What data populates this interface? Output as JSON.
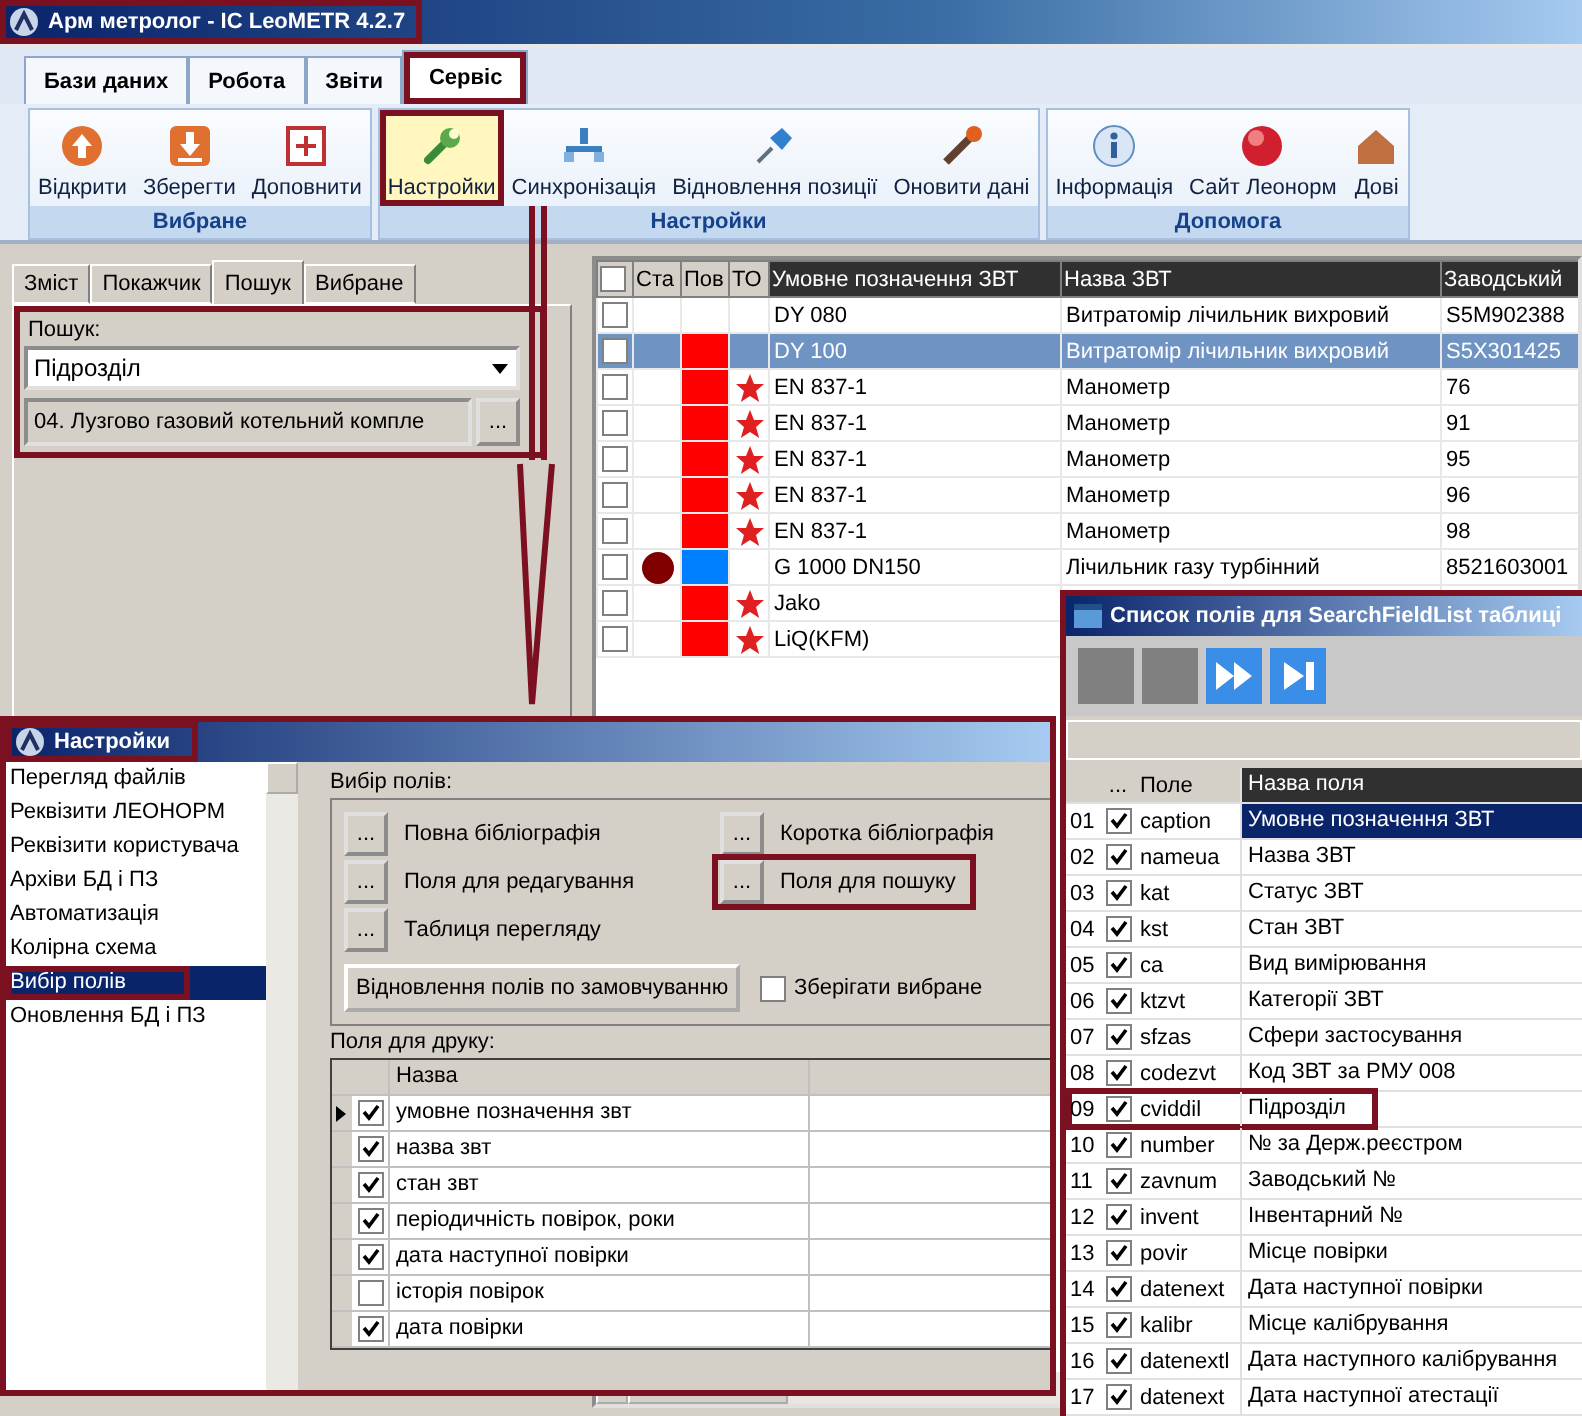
{
  "window": {
    "title": "Арм метролог - IC LeoMETR 4.2.7"
  },
  "ribbon_tabs": [
    {
      "label": "Бази даних",
      "selected": false
    },
    {
      "label": "Робота",
      "selected": false
    },
    {
      "label": "Звіти",
      "selected": false
    },
    {
      "label": "Сервіс",
      "selected": true
    }
  ],
  "ribbon_groups": [
    {
      "title": "Вибране",
      "buttons": [
        {
          "label": "Відкрити",
          "selected": false
        },
        {
          "label": "Зберегти",
          "selected": false
        },
        {
          "label": "Доповнити",
          "selected": false
        }
      ]
    },
    {
      "title": "Настройки",
      "buttons": [
        {
          "label": "Настройки",
          "selected": true
        },
        {
          "label": "Синхронізація",
          "selected": false
        },
        {
          "label": "Відновлення позиції",
          "selected": false
        },
        {
          "label": "Оновити дані",
          "selected": false
        }
      ]
    },
    {
      "title": "Допомога",
      "buttons": [
        {
          "label": "Інформація",
          "selected": false
        },
        {
          "label": "Сайт  Леонорм",
          "selected": false
        },
        {
          "label": "Дові",
          "selected": false
        }
      ]
    }
  ],
  "side_tabs": [
    {
      "label": "Зміст",
      "selected": false
    },
    {
      "label": "Покажчик",
      "selected": false
    },
    {
      "label": "Пошук",
      "selected": true
    },
    {
      "label": "Вибране",
      "selected": false
    }
  ],
  "search": {
    "label": "Пошук:",
    "field": "Підрозділ",
    "value": "04. Лузгово газовий котельний компле",
    "button": "..."
  },
  "table": {
    "all_checked": false,
    "columns": [
      "Ста",
      "Пов",
      "ТО",
      "Умовне позначення ЗВТ",
      "Назва ЗВТ",
      "Заводський"
    ],
    "rows": [
      {
        "checked": false,
        "selected": false,
        "star": false,
        "caption": "DY 080",
        "name": "Витратомір лічильник вихровий",
        "serial": "S5M902388"
      },
      {
        "checked": false,
        "selected": true,
        "star": false,
        "pov_mark": {
          "color": "#ff0000"
        },
        "caption": "DY 100",
        "name": "Витратомір лічильник вихровий",
        "serial": "S5X301425"
      },
      {
        "checked": false,
        "selected": false,
        "star": true,
        "pov_mark": {
          "color": "#ff0000"
        },
        "caption": "EN 837-1",
        "name": "Манометр",
        "serial": "76"
      },
      {
        "checked": false,
        "selected": false,
        "star": true,
        "pov_mark": {
          "color": "#ff0000"
        },
        "caption": "EN 837-1",
        "name": "Манометр",
        "serial": "91"
      },
      {
        "checked": false,
        "selected": false,
        "star": true,
        "pov_mark": {
          "color": "#ff0000"
        },
        "caption": "EN 837-1",
        "name": "Манометр",
        "serial": "95"
      },
      {
        "checked": false,
        "selected": false,
        "star": true,
        "pov_mark": {
          "color": "#ff0000"
        },
        "caption": "EN 837-1",
        "name": "Манометр",
        "serial": "96"
      },
      {
        "checked": false,
        "selected": false,
        "star": true,
        "pov_mark": {
          "color": "#ff0000"
        },
        "caption": "EN 837-1",
        "name": "Манометр",
        "serial": "98"
      },
      {
        "checked": false,
        "selected": false,
        "star": false,
        "status_mark": {
          "color": "#800000"
        },
        "pov_mark": {
          "color": "#0080ff"
        },
        "caption": "G 1000 DN150",
        "name": "Лічильник газу турбінний",
        "serial": "8521603001"
      },
      {
        "checked": false,
        "selected": false,
        "star": true,
        "pov_mark": {
          "color": "#ff0000"
        },
        "caption": "Jako"
      },
      {
        "checked": false,
        "selected": false,
        "star": true,
        "pov_mark": {
          "color": "#ff0000"
        },
        "caption": "LiQ(KFM)"
      }
    ]
  },
  "settings_dialog": {
    "title": "Настройки",
    "nav_items": [
      {
        "label": "Перегляд файлів",
        "selected": false
      },
      {
        "label": "Реквізити ЛЕОНОРМ",
        "selected": false
      },
      {
        "label": "Реквізити користувача",
        "selected": false
      },
      {
        "label": "Архіви БД і ПЗ",
        "selected": false
      },
      {
        "label": "Автоматизація",
        "selected": false
      },
      {
        "label": "Колірна схема",
        "selected": false
      },
      {
        "label": "Вибір полів",
        "selected": true
      },
      {
        "label": "Оновлення БД і ПЗ",
        "selected": false
      }
    ],
    "fields_label": "Вибір полів:",
    "field_sets": [
      {
        "button": "...",
        "label": "Повна бібліографія"
      },
      {
        "button": "...",
        "label": "Коротка бібліографія"
      },
      {
        "button": "...",
        "label": "Поля  для редагування"
      },
      {
        "button": "...",
        "label": "Поля  для пошуку"
      },
      {
        "button": "...",
        "label": "Таблиця перегляду"
      }
    ],
    "reset_button": "Відновлення полів по замовчуванню",
    "keep_selected": {
      "label": "Зберігати вибране",
      "checked": false
    },
    "print_label": "Поля для друку:",
    "print_column": "Назва",
    "print_fields": [
      {
        "label": "умовне позначення звт",
        "checked": true,
        "current": true
      },
      {
        "label": "назва звт",
        "checked": true,
        "current": false
      },
      {
        "label": "стан звт",
        "checked": true,
        "current": false
      },
      {
        "label": "періодичність повірок, роки",
        "checked": true,
        "current": false
      },
      {
        "label": "дата наступної повірки",
        "checked": true,
        "current": false
      },
      {
        "label": "історія повірок",
        "checked": false,
        "current": false
      },
      {
        "label": "дата повірки",
        "checked": true,
        "current": false
      }
    ]
  },
  "field_list_dialog": {
    "title": "Список полів для SearchFieldList таблиці",
    "columns": [
      "...",
      "Поле",
      "Назва поля"
    ],
    "rows": [
      {
        "number": "01",
        "checked": true,
        "field": "caption",
        "name": "Умовне позначення ЗВТ",
        "selected": true
      },
      {
        "number": "02",
        "checked": true,
        "field": "nameua",
        "name": "Назва ЗВТ",
        "selected": false
      },
      {
        "number": "03",
        "checked": true,
        "field": "kat",
        "name": "Статус ЗВТ",
        "selected": false
      },
      {
        "number": "04",
        "checked": true,
        "field": "kst",
        "name": "Стан ЗВТ",
        "selected": false
      },
      {
        "number": "05",
        "checked": true,
        "field": "ca",
        "name": "Вид вимірювання",
        "selected": false
      },
      {
        "number": "06",
        "checked": true,
        "field": "ktzvt",
        "name": "Категорії ЗВТ",
        "selected": false
      },
      {
        "number": "07",
        "checked": true,
        "field": "sfzas",
        "name": "Сфери застосування",
        "selected": false
      },
      {
        "number": "08",
        "checked": true,
        "field": "codezvt",
        "name": "Код ЗВТ за РМУ 008",
        "selected": false
      },
      {
        "number": "09",
        "checked": true,
        "field": "cviddil",
        "name": "Підрозділ",
        "selected": false
      },
      {
        "number": "10",
        "checked": true,
        "field": "number",
        "name": "№ за Держ.реєстром",
        "selected": false
      },
      {
        "number": "11",
        "checked": true,
        "field": "zavnum",
        "name": "Заводський №",
        "selected": false
      },
      {
        "number": "12",
        "checked": true,
        "field": "invent",
        "name": "Інвентарний №",
        "selected": false
      },
      {
        "number": "13",
        "checked": true,
        "field": "povir",
        "name": "Місце повірки",
        "selected": false
      },
      {
        "number": "14",
        "checked": true,
        "field": "datenext",
        "name": "Дата наступної повірки",
        "selected": false
      },
      {
        "number": "15",
        "checked": true,
        "field": "kalibr",
        "name": "Місце калібрування",
        "selected": false
      },
      {
        "number": "16",
        "checked": true,
        "field": "datenextl",
        "name": "Дата наступного калібрування",
        "selected": false
      },
      {
        "number": "17",
        "checked": true,
        "field": "datenext",
        "name": "Дата наступної атестації",
        "selected": false
      }
    ]
  }
}
